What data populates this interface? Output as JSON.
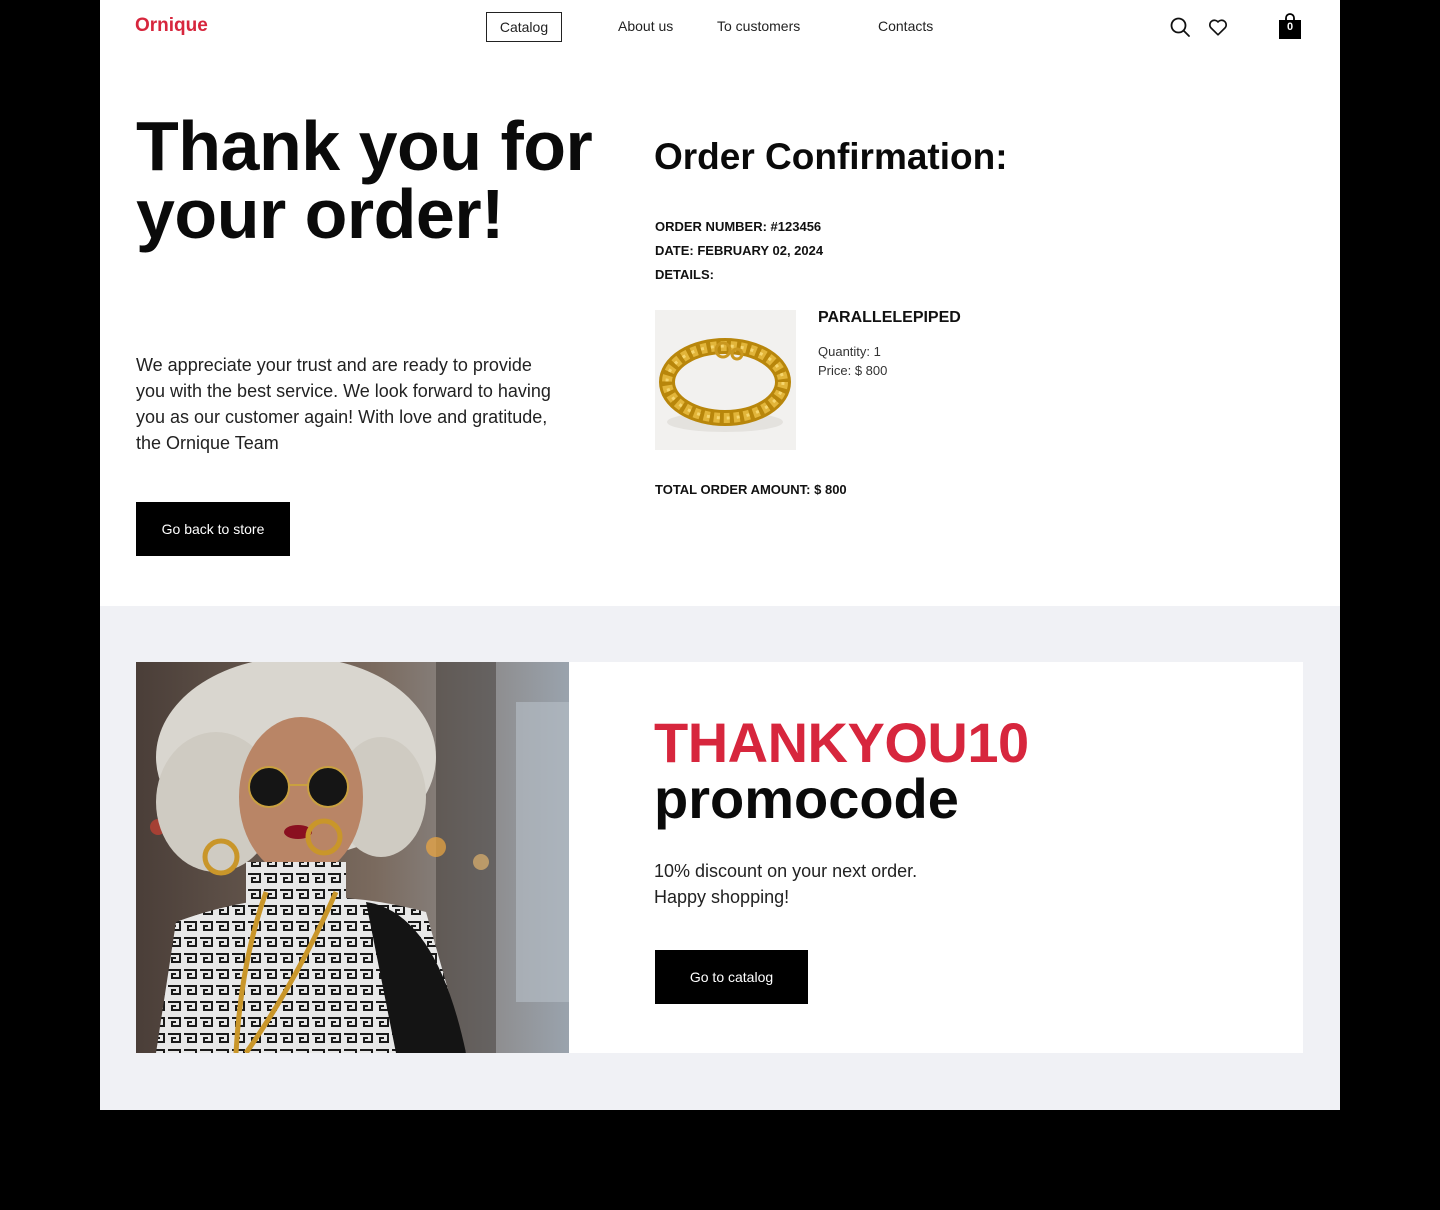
{
  "header": {
    "logo": "Ornique",
    "nav": {
      "catalog": "Catalog",
      "about": "About us",
      "customers": "To customers",
      "contacts": "Contacts"
    },
    "cart_count": "0",
    "icons": [
      "search-icon",
      "heart-icon",
      "cart-icon"
    ]
  },
  "hero": {
    "title": "Thank you for your order!",
    "message": "We appreciate your trust and are ready to provide you with the best service. We look forward to having you as our customer again! With love and gratitude, the Ornique Team",
    "back_button": "Go back to store"
  },
  "order": {
    "title": "Order Confirmation:",
    "number": "ORDER NUMBER: #123456",
    "date": "DATE: FEBRUARY 02, 2024",
    "details_label": "DETAILS:",
    "item": {
      "name": "PARALLELEPIPED",
      "quantity": "Quantity: 1",
      "price": "Price: $ 800"
    },
    "total": "TOTAL ORDER AMOUNT: $ 800"
  },
  "promo": {
    "code": "THANKYOU10",
    "word": "promocode",
    "text_line1": "10% discount on your next order.",
    "text_line2": "Happy shopping!",
    "button": "Go to catalog"
  },
  "colors": {
    "accent": "#d7263d",
    "black": "#000000",
    "promo_bg": "#f0f1f5"
  }
}
